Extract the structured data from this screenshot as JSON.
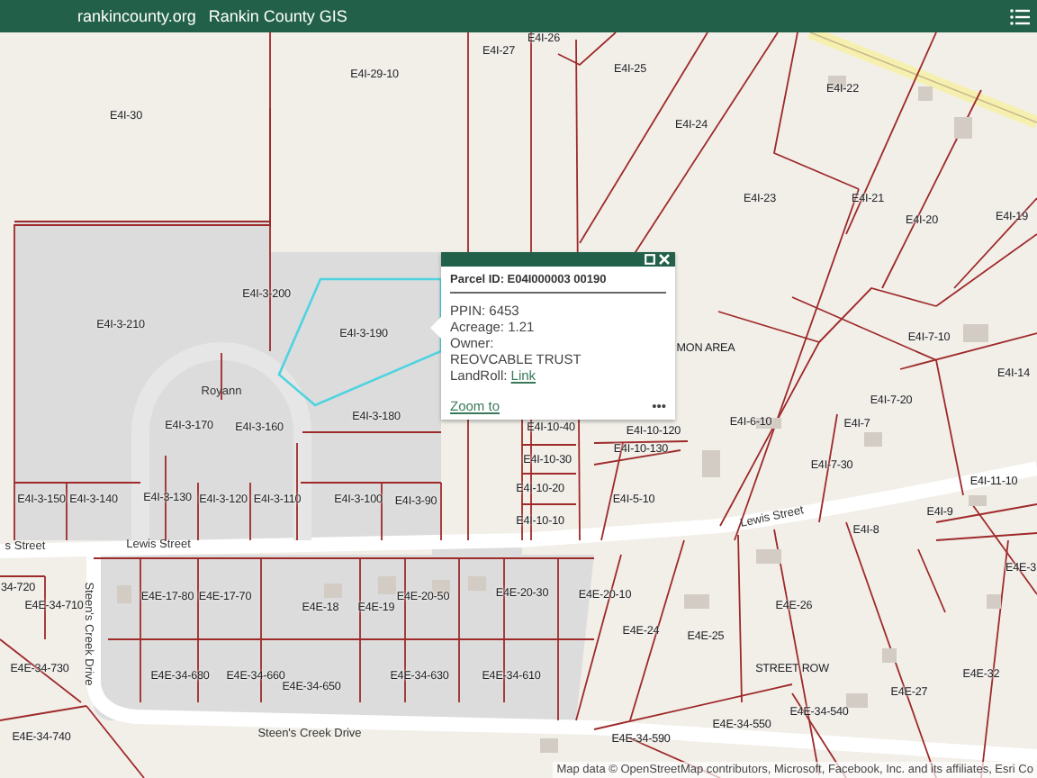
{
  "header": {
    "site_link": "rankincounty.org",
    "title": "Rankin County GIS"
  },
  "map": {
    "parcels": [
      {
        "label": "E4I-30"
      },
      {
        "label": "E4I-29-10"
      },
      {
        "label": "E4I-27"
      },
      {
        "label": "E4I-26"
      },
      {
        "label": "E4I-25"
      },
      {
        "label": "E4I-24"
      },
      {
        "label": "E4I-22"
      },
      {
        "label": "E4I-23"
      },
      {
        "label": "E4I-21"
      },
      {
        "label": "E4I-20"
      },
      {
        "label": "E4I-19"
      },
      {
        "label": "E4I-3-210"
      },
      {
        "label": "E4I-3-200"
      },
      {
        "label": "E4I-3-190"
      },
      {
        "label": "E4I-3-170"
      },
      {
        "label": "E4I-3-160"
      },
      {
        "label": "E4I-3-180"
      },
      {
        "label": "E4I-3-150"
      },
      {
        "label": "E4I-3-140"
      },
      {
        "label": "E4I-3-130"
      },
      {
        "label": "E4I-3-120"
      },
      {
        "label": "E4I-3-110"
      },
      {
        "label": "E4I-3-100"
      },
      {
        "label": "E4I-3-90"
      },
      {
        "label": "MON AREA"
      },
      {
        "label": "E4I-10-40"
      },
      {
        "label": "E4I-10-120"
      },
      {
        "label": "E4I-10-130"
      },
      {
        "label": "E4I-10-30"
      },
      {
        "label": "E4I-10-20"
      },
      {
        "label": "E4I-5-10"
      },
      {
        "label": "E4I-10-10"
      },
      {
        "label": "E4I-7-10"
      },
      {
        "label": "E4I-14"
      },
      {
        "label": "E4I-7-20"
      },
      {
        "label": "E4I-6-10"
      },
      {
        "label": "E4I-7"
      },
      {
        "label": "E4I-7-30"
      },
      {
        "label": "E4I-11-10"
      },
      {
        "label": "E4I-9"
      },
      {
        "label": "E4I-8"
      },
      {
        "label": "34-720"
      },
      {
        "label": "E4E-34-710"
      },
      {
        "label": "E4E-17-80"
      },
      {
        "label": "E4E-17-70"
      },
      {
        "label": "E4E-18"
      },
      {
        "label": "E4E-19"
      },
      {
        "label": "E4E-20-50"
      },
      {
        "label": "E4E-20-30"
      },
      {
        "label": "E4E-20-10"
      },
      {
        "label": "E4E-3"
      },
      {
        "label": "E4E-24"
      },
      {
        "label": "E4E-25"
      },
      {
        "label": "E4E-26"
      },
      {
        "label": "E4E-34-730"
      },
      {
        "label": "E4E-34-680"
      },
      {
        "label": "E4E-34-660"
      },
      {
        "label": "E4E-34-650"
      },
      {
        "label": "E4E-34-630"
      },
      {
        "label": "E4E-34-610"
      },
      {
        "label": "STREET ROW"
      },
      {
        "label": "E4E-32"
      },
      {
        "label": "E4E-27"
      },
      {
        "label": "E4E-34-540"
      },
      {
        "label": "E4E-34-740"
      },
      {
        "label": "E4E-34-550"
      },
      {
        "label": "E4E-34-590"
      }
    ],
    "streets": [
      {
        "label": "Royann"
      },
      {
        "label": "s Street"
      },
      {
        "label": "Lewis Street"
      },
      {
        "label": "Lewis Street"
      },
      {
        "label": "Steen's Creek Drive"
      },
      {
        "label": "Steen's Creek Drive"
      }
    ],
    "attribution": "Map data © OpenStreetMap contributors, Microsoft, Facebook, Inc. and its affiliates, Esri Co"
  },
  "popup": {
    "title": "Parcel ID: E04I000003 00190",
    "fields": [
      {
        "kind": "pair",
        "label": "PPIN:",
        "value": "6453"
      },
      {
        "kind": "pair",
        "label": "Acreage:",
        "value": "1.21"
      },
      {
        "kind": "pair",
        "label": "Owner:"
      },
      {
        "kind": "text",
        "value": "REOVCABLE TRUST"
      },
      {
        "kind": "link",
        "label": "LandRoll:",
        "value": "Link"
      }
    ],
    "zoom_link": "Zoom to",
    "more": "•••"
  }
}
